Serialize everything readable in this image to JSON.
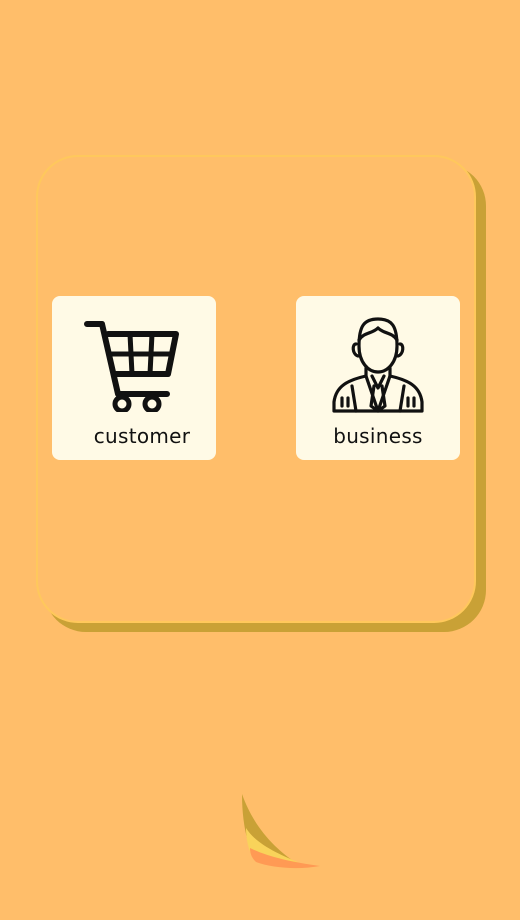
{
  "roles": {
    "customer": {
      "label": "customer",
      "icon": "shopping-cart-icon"
    },
    "business": {
      "label": "business",
      "icon": "businessman-icon"
    }
  },
  "logo": {
    "icon": "sail-logo-icon"
  },
  "colors": {
    "background": "#FFBE6A",
    "panel_shadow": "#C9A136",
    "card": "#FFFAE6",
    "ink": "#111111"
  }
}
